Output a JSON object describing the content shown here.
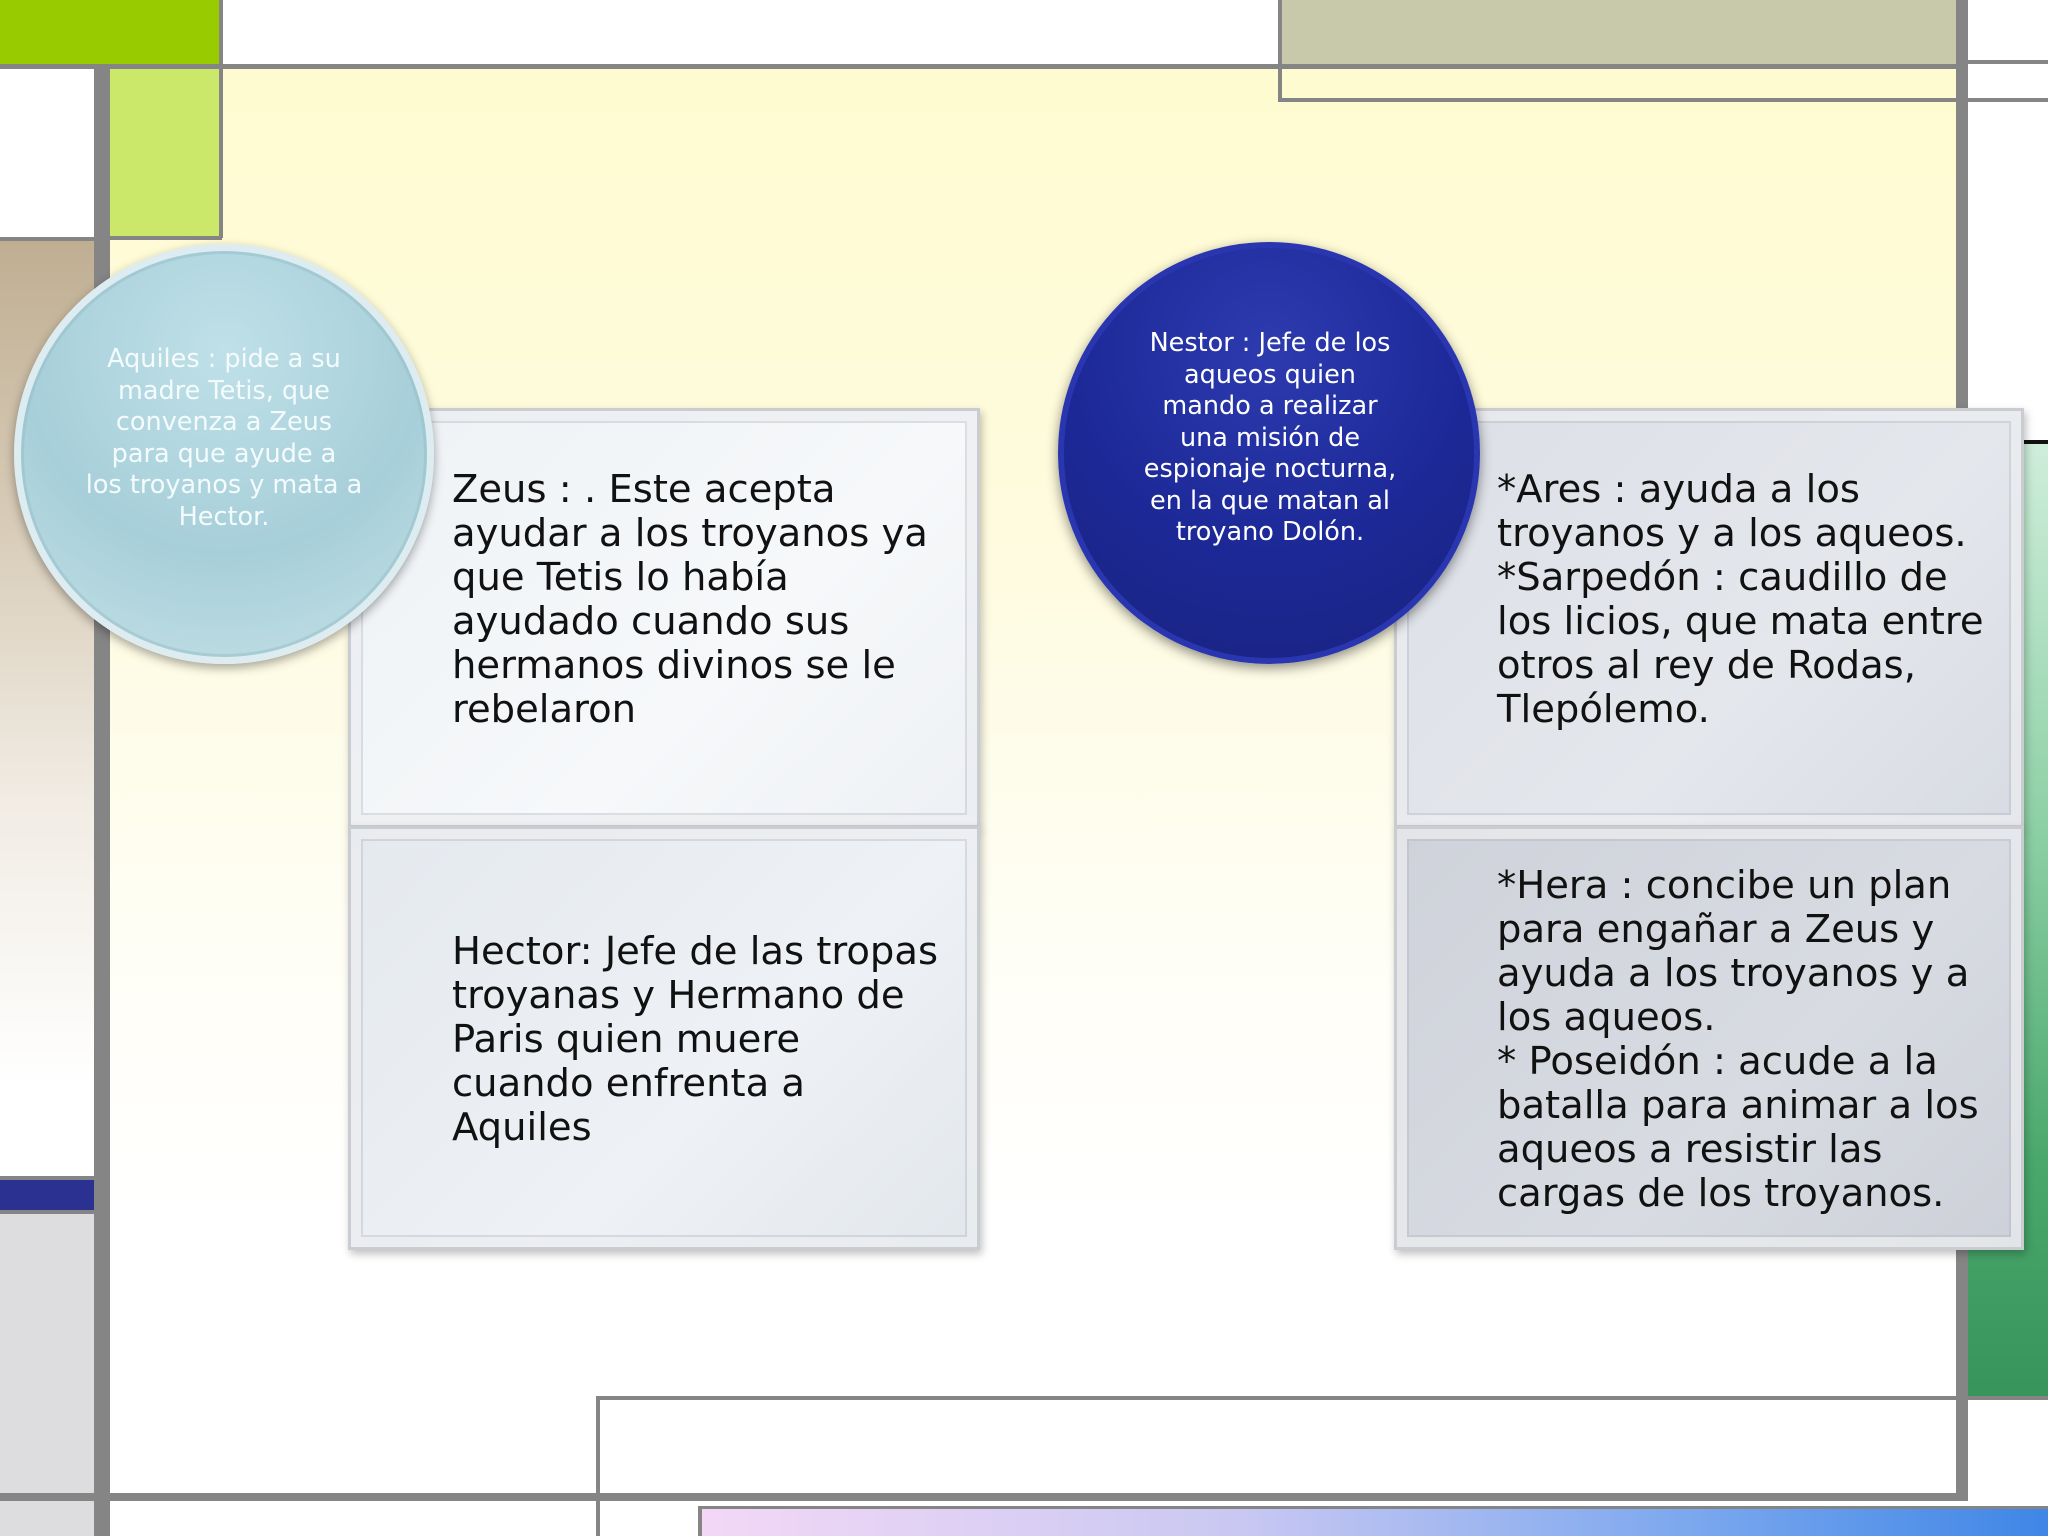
{
  "slide": {
    "left": {
      "circle": {
        "text": "Aquiles : pide a su\nmadre Tetis, que\nconvenza a Zeus\npara que ayude a\nlos troyanos y mata a\nHector."
      },
      "box_top": {
        "text": "Zeus : . Este acepta\nayudar a los troyanos ya\nque Tetis lo había\nayudado cuando sus\nhermanos divinos se le\nrebelaron"
      },
      "box_bottom": {
        "text": "Hector: Jefe de las tropas\ntroyanas y Hermano de\nParis quien muere\ncuando enfrenta a\nAquiles"
      }
    },
    "right": {
      "circle": {
        "text": "Nestor : Jefe de los\naqueos quien\nmando a realizar\nuna misión de\nespionaje nocturna,\nen la que matan al\ntroyano Dolón."
      },
      "box_top": {
        "text": "*Ares : ayuda a los\ntroyanos y a los aqueos.\n*Sarpedón : caudillo de\nlos licios, que mata entre\notros al rey de Rodas,\nTlepólemo."
      },
      "box_bottom": {
        "text": "*Hera : concibe un plan\npara engañar a Zeus y\nayuda a los troyanos y a\nlos aqueos.\n* Poseidón : acude a la\nbatalla para animar a los\naqueos a resistir las\ncargas de los troyanos."
      }
    }
  },
  "colors": {
    "lime": "#99cc00",
    "light_lime": "#cce86a",
    "khaki": "#c8c9aa",
    "tan": "#bfae92",
    "navy": "#2b3190",
    "green": "#3d9e62",
    "grey_block": "#dddde0",
    "circle_light": "#a8d0dc",
    "circle_dark": "#1c2896"
  }
}
